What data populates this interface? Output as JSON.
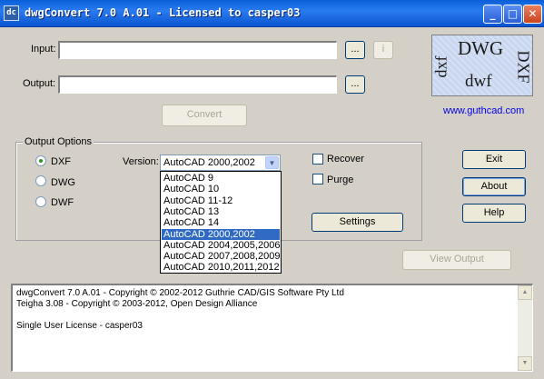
{
  "window": {
    "title": "dwgConvert 7.0 A.01 - Licensed to casper03",
    "icon_text": "dc",
    "controls": {
      "minimize": "_",
      "maximize": "□",
      "close": "✕"
    }
  },
  "input": {
    "label": "Input:",
    "value": "",
    "browse_label": "...",
    "info_label": "i"
  },
  "output": {
    "label": "Output:",
    "value": "",
    "browse_label": "..."
  },
  "convert_label": "Convert",
  "logo": {
    "dwg": "DWG",
    "dxf": "DXF",
    "dxb": "dxf",
    "dwf": "dwf"
  },
  "website": "www.guthcad.com",
  "options": {
    "legend": "Output Options",
    "formats": [
      {
        "label": "DXF",
        "selected": true
      },
      {
        "label": "DWG",
        "selected": false
      },
      {
        "label": "DWF",
        "selected": false
      }
    ],
    "version_label": "Version:",
    "version_value": "AutoCAD 2000,2002",
    "version_options": [
      "AutoCAD 9",
      "AutoCAD 10",
      "AutoCAD 11-12",
      "AutoCAD 13",
      "AutoCAD 14",
      "AutoCAD 2000,2002",
      "AutoCAD 2004,2005,2006",
      "AutoCAD 2007,2008,2009",
      "AutoCAD 2010,2011,2012"
    ],
    "selected_version_index": 5,
    "recover_label": "Recover",
    "purge_label": "Purge",
    "settings_label": "Settings"
  },
  "side_buttons": {
    "exit": "Exit",
    "about": "About",
    "help": "Help"
  },
  "view_output_label": "View Output",
  "log_lines": [
    "dwgConvert 7.0 A.01 - Copyright © 2002-2012 Guthrie CAD/GIS Software Pty Ltd",
    "Teigha 3.08 - Copyright © 2003-2012, Open Design Alliance",
    "",
    "Single User License - casper03"
  ]
}
